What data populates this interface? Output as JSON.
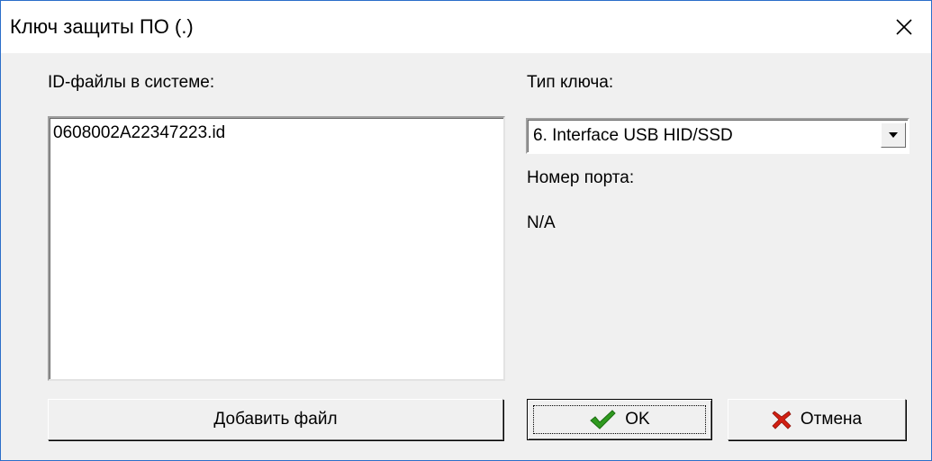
{
  "window": {
    "title": "Ключ защиты ПО (.)"
  },
  "left_panel": {
    "label": "ID-файлы в системе:",
    "files": [
      "0608002A22347223.id"
    ],
    "add_button_label": "Добавить файл"
  },
  "right_panel": {
    "key_type_label": "Тип ключа:",
    "key_type_value": "6. Interface USB HID/SSD",
    "port_label": "Номер порта:",
    "port_value": "N/A"
  },
  "buttons": {
    "ok_label": "OK",
    "cancel_label": "Отмена"
  },
  "icons": {
    "close": "close-icon",
    "dropdown": "chevron-down-icon",
    "ok": "check-icon",
    "cancel": "x-mark-icon"
  },
  "colors": {
    "ok_icon": "#2f9a1f",
    "cancel_icon": "#d21f12",
    "window_border": "#2b6ec9"
  }
}
